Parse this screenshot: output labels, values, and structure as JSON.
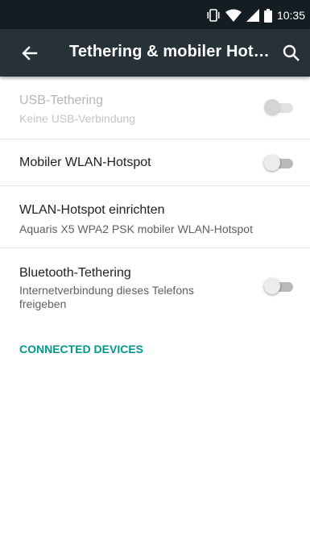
{
  "status_bar": {
    "time": "10:35",
    "icons": [
      "vibrate-icon",
      "wifi-icon",
      "cell-signal-icon",
      "battery-icon"
    ]
  },
  "app_bar": {
    "back_icon": "arrow-back-icon",
    "title": "Tethering & mobiler Hot…",
    "search_icon": "search-icon"
  },
  "settings": [
    {
      "title": "USB-Tethering",
      "summary": "Keine USB-Verbindung",
      "switch": "off",
      "enabled": false
    },
    {
      "title": "Mobiler WLAN-Hotspot",
      "switch": "off",
      "enabled": true
    },
    {
      "title": "WLAN-Hotspot einrichten",
      "summary": "Aquaris X5 WPA2 PSK mobiler WLAN-Hotspot",
      "enabled": true
    },
    {
      "title": "Bluetooth-Tethering",
      "summary": "Internetverbindung dieses Telefons freigeben",
      "switch": "off",
      "enabled": true
    }
  ],
  "section_header": "CONNECTED DEVICES",
  "colors": {
    "status_bar": "#141e22",
    "app_bar": "#263238",
    "accent": "#009688",
    "background": "#ffffff"
  }
}
